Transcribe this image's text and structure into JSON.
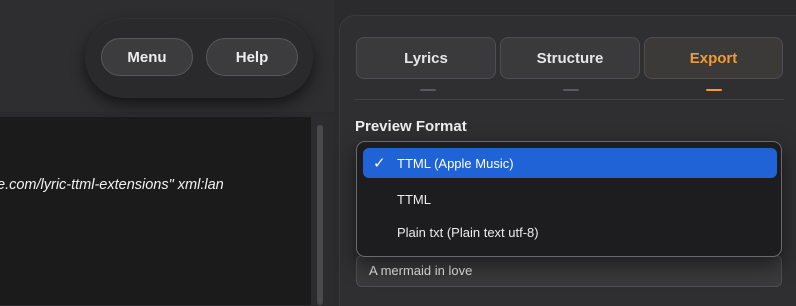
{
  "toolbar": {
    "menu_label": "Menu",
    "help_label": "Help"
  },
  "code": {
    "visible_line": "e.com/lyric-ttml-extensions\" xml:lan"
  },
  "tabs": [
    {
      "label": "Lyrics",
      "active": false
    },
    {
      "label": "Structure",
      "active": false
    },
    {
      "label": "Export",
      "active": true
    }
  ],
  "export": {
    "section_label": "Preview Format",
    "format_dropdown": {
      "selected": "TTML (Apple Music)",
      "options": [
        "TTML (Apple Music)",
        "TTML",
        "Plain txt (Plain text utf-8)"
      ]
    },
    "text_field_value": "A mermaid in love"
  },
  "colors": {
    "accent": "#f29a33",
    "selection": "#1f63d6",
    "background": "#2b2b2d"
  }
}
